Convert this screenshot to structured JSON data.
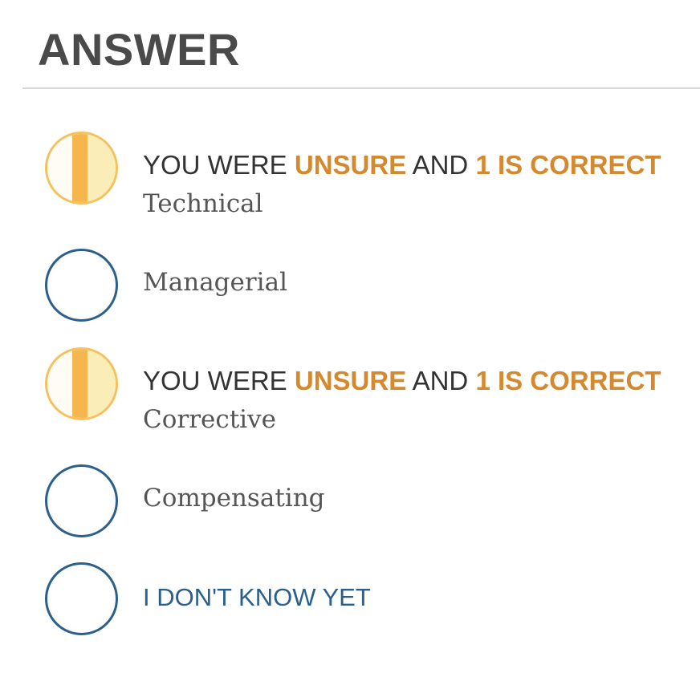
{
  "header": {
    "title": "ANSWER"
  },
  "status": {
    "prefix": "YOU WERE",
    "confidence": "UNSURE",
    "joiner": "AND",
    "result": "1 IS CORRECT"
  },
  "options": [
    {
      "label": "Technical",
      "state": "unsure",
      "show_status": true
    },
    {
      "label": "Managerial",
      "state": "empty",
      "show_status": false
    },
    {
      "label": "Corrective",
      "state": "unsure",
      "show_status": true
    },
    {
      "label": "Compensating",
      "state": "empty",
      "show_status": false
    }
  ],
  "dont_know": {
    "label": "I DON'T KNOW YET",
    "state": "empty"
  },
  "colors": {
    "heading": "#4a4a4a",
    "divider": "#d8d8d8",
    "highlight": "#d4892f",
    "empty_ring": "#2c5f89",
    "unsure_ring": "#f5c15d",
    "unsure_bar": "#f5b74d",
    "unsure_fill": "#fbedb8",
    "dont_know_text": "#2b5f8b"
  }
}
